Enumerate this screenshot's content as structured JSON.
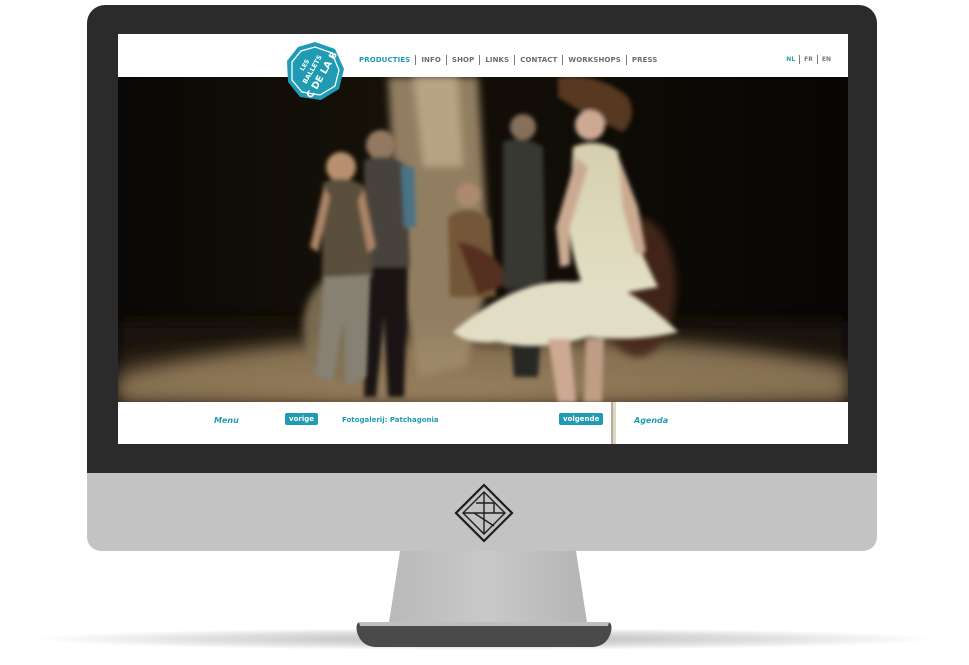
{
  "brand": {
    "logo_text_line1": "LES",
    "logo_text_line2": "BALLETS",
    "logo_text_line3": "C DE LA B",
    "accent_color": "#1f9bb4"
  },
  "nav": {
    "items": [
      {
        "label": "PRODUCTIES",
        "active": true
      },
      {
        "label": "INFO",
        "active": false
      },
      {
        "label": "SHOP",
        "active": false
      },
      {
        "label": "LINKS",
        "active": false
      },
      {
        "label": "CONTACT",
        "active": false
      },
      {
        "label": "WORKSHOPS",
        "active": false
      },
      {
        "label": "PRESS",
        "active": false
      }
    ]
  },
  "languages": {
    "items": [
      {
        "label": "NL",
        "active": true
      },
      {
        "label": "FR",
        "active": false
      },
      {
        "label": "EN",
        "active": false
      }
    ]
  },
  "hero": {
    "icon": "dance-performance-photo"
  },
  "footer": {
    "menu_label": "Menu",
    "prev_label": "vorige",
    "gallery_title": "Fotogalerij: Patchagonia",
    "next_label": "volgende",
    "agenda_label": "Agenda"
  },
  "device": {
    "chin_icon": "diamond-monogram-icon"
  }
}
